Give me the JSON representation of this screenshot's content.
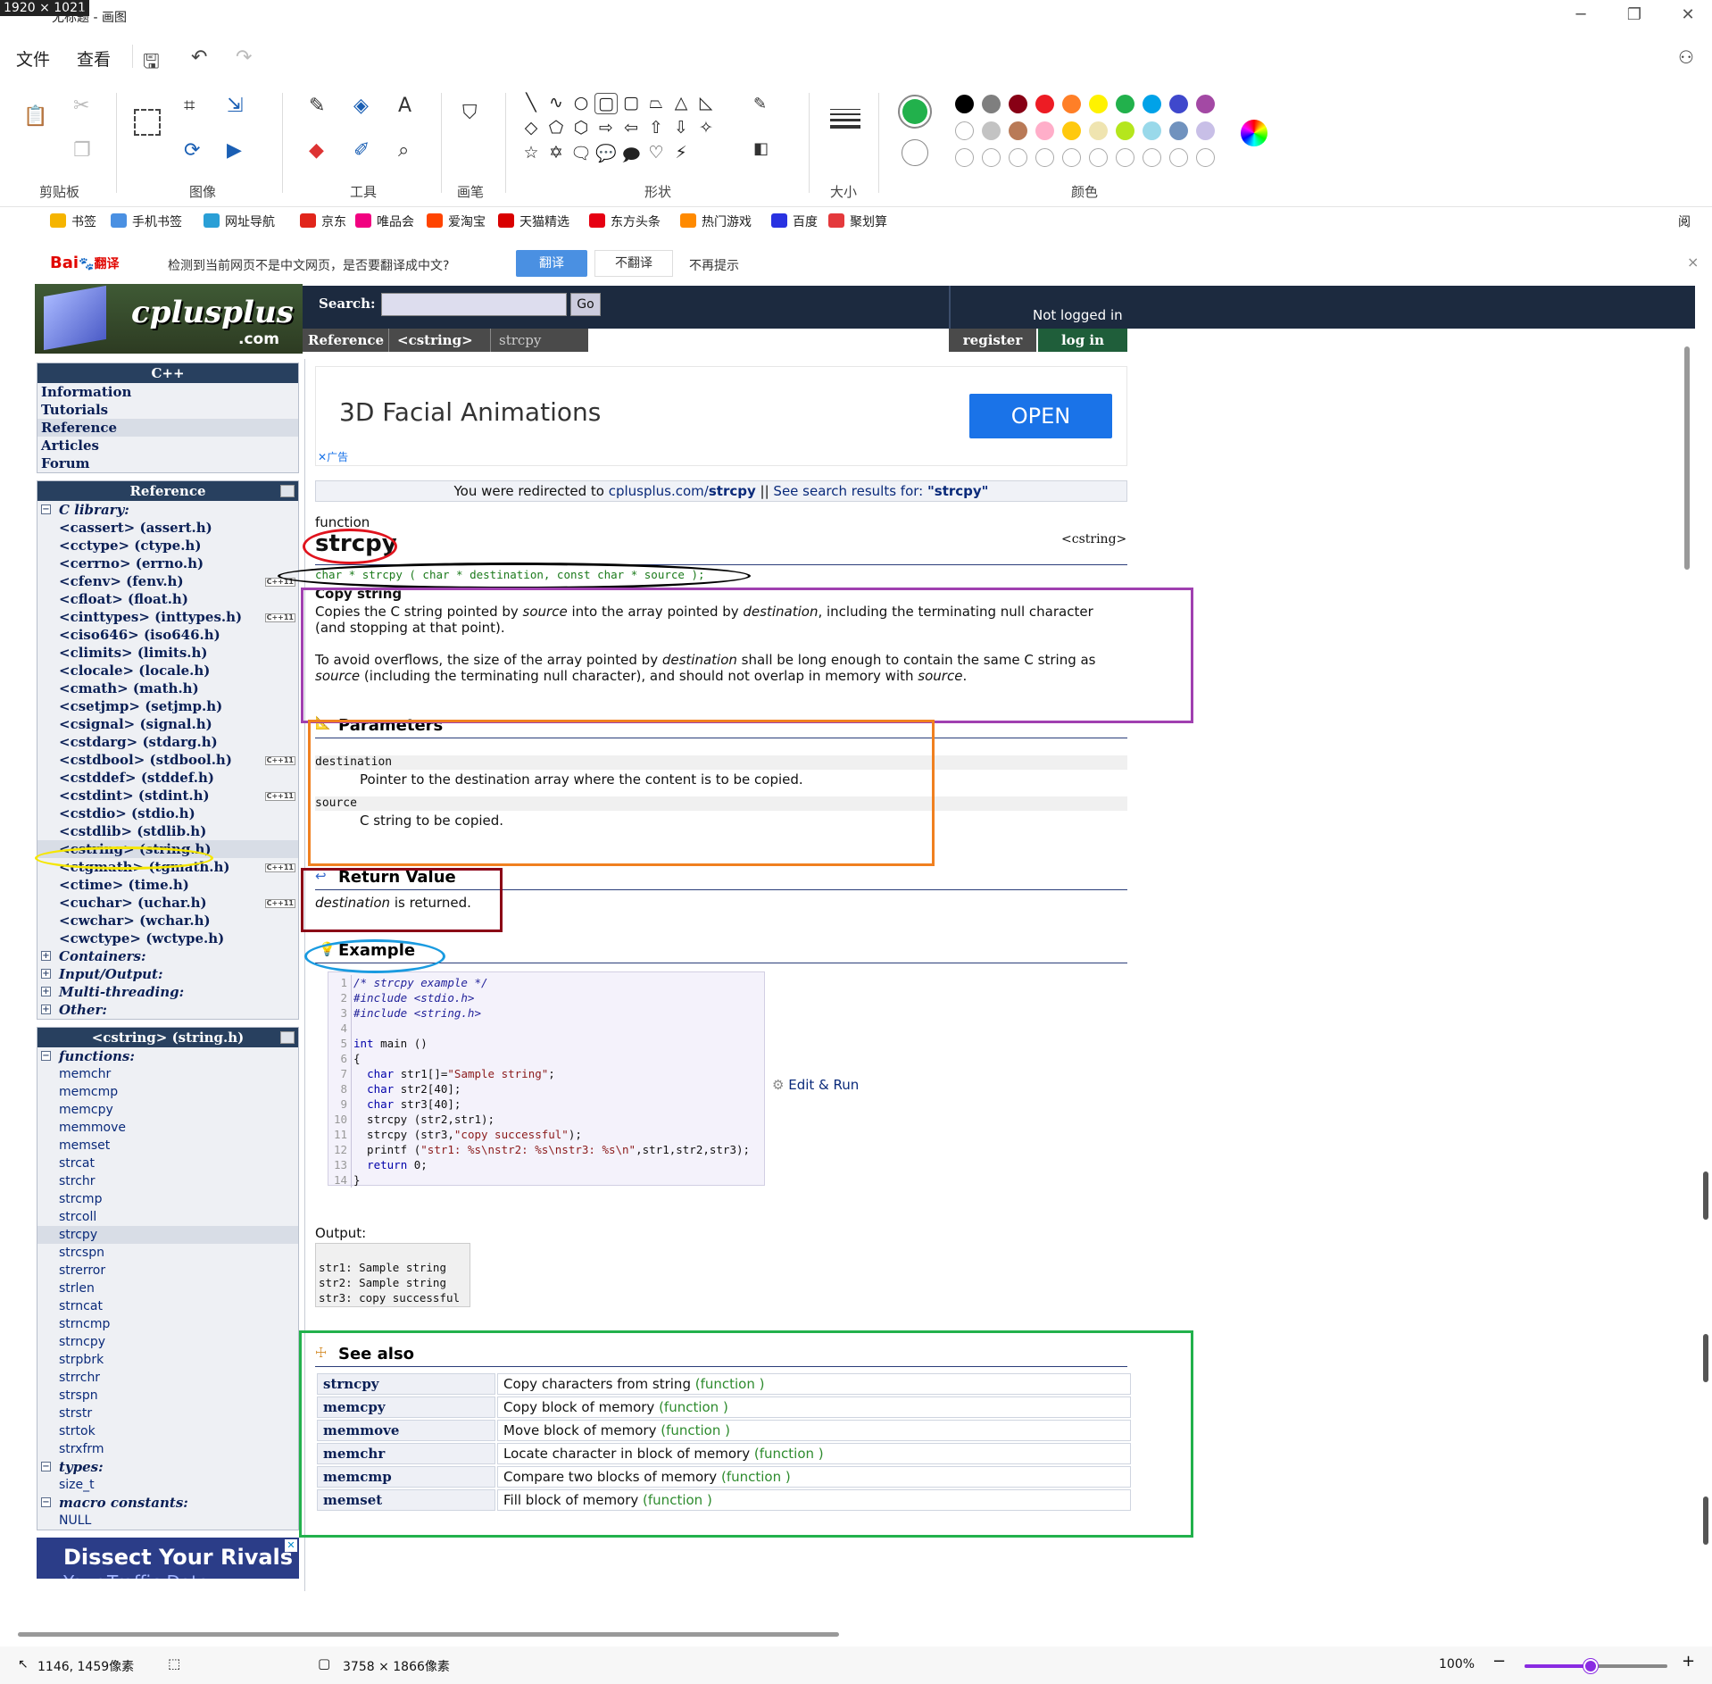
{
  "window": {
    "dims_tag": "1920 × 1021",
    "title": "无标题 - 画图",
    "minimize": "─",
    "restore": "❐",
    "close": "✕"
  },
  "menu": {
    "file": "文件",
    "view": "查看"
  },
  "ribbon": {
    "groups": {
      "clipboard": "剪贴板",
      "image": "图像",
      "tools": "工具",
      "brushes": "画笔",
      "shapes": "形状",
      "size": "大小",
      "colors": "颜色"
    },
    "colors_row1": [
      "#000000",
      "#7f7f7f",
      "#880015",
      "#ed1c24",
      "#ff7f27",
      "#fff200",
      "#22b14c",
      "#00a2e8",
      "#3f48cc",
      "#a349a4"
    ],
    "colors_row2": [
      "#ffffff",
      "#c3c3c3",
      "#b97a57",
      "#ffaec9",
      "#ffc90e",
      "#efe4b0",
      "#b5e61d",
      "#99d9ea",
      "#7092be",
      "#c8bfe7"
    ],
    "primary_color": "#22b14c"
  },
  "bookmarks": [
    {
      "label": "书签",
      "color": "#f5b400"
    },
    {
      "label": "手机书签",
      "color": "#4a90e2"
    },
    {
      "label": "网址导航",
      "color": "#2a9fd6"
    },
    {
      "label": "京东",
      "color": "#e1251b"
    },
    {
      "label": "唯品会",
      "color": "#f10180"
    },
    {
      "label": "爱淘宝",
      "color": "#ff4400"
    },
    {
      "label": "天猫精选",
      "color": "#d90000"
    },
    {
      "label": "东方头条",
      "color": "#e60012"
    },
    {
      "label": "热门游戏",
      "color": "#ff8a00"
    },
    {
      "label": "百度",
      "color": "#2932e1"
    },
    {
      "label": "聚划算",
      "color": "#e4393c"
    }
  ],
  "bookmark_right": "阅",
  "translate": {
    "logo_a": "Bai",
    "logo_b": "翻译",
    "message": "检测到当前网页不是中文网页，是否要翻译成中文?",
    "translate_btn": "翻译",
    "no_translate_btn": "不翻译",
    "no_prompt": "不再提示",
    "close": "×"
  },
  "site": {
    "logo_text": "cplusplus",
    "logo_sub": ".com",
    "search_label": "Search:",
    "go": "Go",
    "not_logged_in": "Not logged in",
    "register": "register",
    "login": "log in",
    "breadcrumbs": [
      "Reference",
      "<cstring>",
      "strcpy"
    ]
  },
  "left_nav": {
    "cpp": {
      "title": "C++",
      "items": [
        "Information",
        "Tutorials",
        "Reference",
        "Articles",
        "Forum"
      ]
    },
    "reference": {
      "title": "Reference",
      "c_library": "C library:",
      "headers": [
        {
          "name": "<cassert> (assert.h)",
          "cxx": false
        },
        {
          "name": "<cctype> (ctype.h)",
          "cxx": false
        },
        {
          "name": "<cerrno> (errno.h)",
          "cxx": false
        },
        {
          "name": "<cfenv> (fenv.h)",
          "cxx": true
        },
        {
          "name": "<cfloat> (float.h)",
          "cxx": false
        },
        {
          "name": "<cinttypes> (inttypes.h)",
          "cxx": true
        },
        {
          "name": "<ciso646> (iso646.h)",
          "cxx": false
        },
        {
          "name": "<climits> (limits.h)",
          "cxx": false
        },
        {
          "name": "<clocale> (locale.h)",
          "cxx": false
        },
        {
          "name": "<cmath> (math.h)",
          "cxx": false
        },
        {
          "name": "<csetjmp> (setjmp.h)",
          "cxx": false
        },
        {
          "name": "<csignal> (signal.h)",
          "cxx": false
        },
        {
          "name": "<cstdarg> (stdarg.h)",
          "cxx": false
        },
        {
          "name": "<cstdbool> (stdbool.h)",
          "cxx": true
        },
        {
          "name": "<cstddef> (stddef.h)",
          "cxx": false
        },
        {
          "name": "<cstdint> (stdint.h)",
          "cxx": true
        },
        {
          "name": "<cstdio> (stdio.h)",
          "cxx": false
        },
        {
          "name": "<cstdlib> (stdlib.h)",
          "cxx": false
        },
        {
          "name": "<cstring> (string.h)",
          "cxx": false
        },
        {
          "name": "<ctgmath> (tgmath.h)",
          "cxx": true
        },
        {
          "name": "<ctime> (time.h)",
          "cxx": false
        },
        {
          "name": "<cuchar> (uchar.h)",
          "cxx": true
        },
        {
          "name": "<cwchar> (wchar.h)",
          "cxx": false
        },
        {
          "name": "<cwctype> (wctype.h)",
          "cxx": false
        }
      ],
      "categories": [
        "Containers:",
        "Input/Output:",
        "Multi-threading:",
        "Other:"
      ],
      "cxx_badge": "C++11"
    },
    "cstring": {
      "title": "<cstring> (string.h)",
      "functions_label": "functions:",
      "functions": [
        "memchr",
        "memcmp",
        "memcpy",
        "memmove",
        "memset",
        "strcat",
        "strchr",
        "strcmp",
        "strcoll",
        "strcpy",
        "strcspn",
        "strerror",
        "strlen",
        "strncat",
        "strncmp",
        "strncpy",
        "strpbrk",
        "strrchr",
        "strspn",
        "strstr",
        "strtok",
        "strxfrm"
      ],
      "types_label": "types:",
      "types": [
        "size_t"
      ],
      "macro_label": "macro constants:",
      "macros": [
        "NULL"
      ]
    },
    "ad": "Dissect Your Rivals",
    "ad_sub": "Your Traffic Data"
  },
  "ad": {
    "title": "3D Facial Animations",
    "button": "OPEN",
    "label": "广告"
  },
  "redirect": {
    "prefix": "You were redirected to ",
    "domain": "cplusplus.com/",
    "page": "strcpy",
    "sep": " || ",
    "search_text": "See search results for: ",
    "query": "\"strcpy\""
  },
  "article": {
    "kind": "function",
    "name": "strcpy",
    "header": "<cstring>",
    "proto": {
      "ret": "char * ",
      "fn": "strcpy",
      "args": " ( char * destination, const char * source );"
    },
    "summary": "Copy string",
    "desc1": {
      "a": "Copies the C string pointed by ",
      "b": "source",
      "c": " into the array pointed by ",
      "d": "destination",
      "e": ", including the terminating null character",
      "f": "(and stopping at that point)."
    },
    "desc2": {
      "a": "To avoid overflows, the size of the array pointed by ",
      "b": "destination",
      "c": " shall be long enough to contain the same C string as",
      "d": "source",
      "e": " (including the terminating null character), and should not overlap in memory with ",
      "f": "source",
      "g": "."
    },
    "params_title": "Parameters",
    "params": [
      {
        "name": "destination",
        "desc": "Pointer to the destination array where the content is to be copied."
      },
      {
        "name": "source",
        "desc": "C string to be copied."
      }
    ],
    "return_title": "Return Value",
    "return_a": "destination",
    "return_b": " is returned.",
    "example_title": "Example",
    "code": [
      "/* strcpy example */",
      "#include <stdio.h>",
      "#include <string.h>",
      "",
      "int main ()",
      "{",
      "  char str1[]=\"Sample string\";",
      "  char str2[40];",
      "  char str3[40];",
      "  strcpy (str2,str1);",
      "  strcpy (str3,\"copy successful\");",
      "  printf (\"str1: %s\\nstr2: %s\\nstr3: %s\\n\",str1,str2,str3);",
      "  return 0;",
      "}"
    ],
    "edit_run": "Edit & Run",
    "output_label": "Output:",
    "output": [
      "str1: Sample string",
      "str2: Sample string",
      "str3: copy successful"
    ],
    "see_also_title": "See also",
    "see_also": [
      {
        "name": "strncpy",
        "desc": "Copy characters from string ",
        "kind": "(function )"
      },
      {
        "name": "memcpy",
        "desc": "Copy block of memory ",
        "kind": "(function )"
      },
      {
        "name": "memmove",
        "desc": "Move block of memory ",
        "kind": "(function )"
      },
      {
        "name": "memchr",
        "desc": "Locate character in block of memory ",
        "kind": "(function )"
      },
      {
        "name": "memcmp",
        "desc": "Compare two blocks of memory ",
        "kind": "(function )"
      },
      {
        "name": "memset",
        "desc": "Fill block of memory ",
        "kind": "(function )"
      }
    ]
  },
  "annotation_colors": {
    "red": "#e0141e",
    "black": "#000000",
    "purple": "#a040b0",
    "orange": "#f08020",
    "darkred": "#8b0016",
    "blue": "#1a9be0",
    "green": "#22b14c",
    "yellow": "#f5e600"
  },
  "status": {
    "cursor": "1146, 1459像素",
    "canvas": "3758 × 1866像素",
    "zoom": "100%",
    "zoom_fraction": 0.46
  }
}
